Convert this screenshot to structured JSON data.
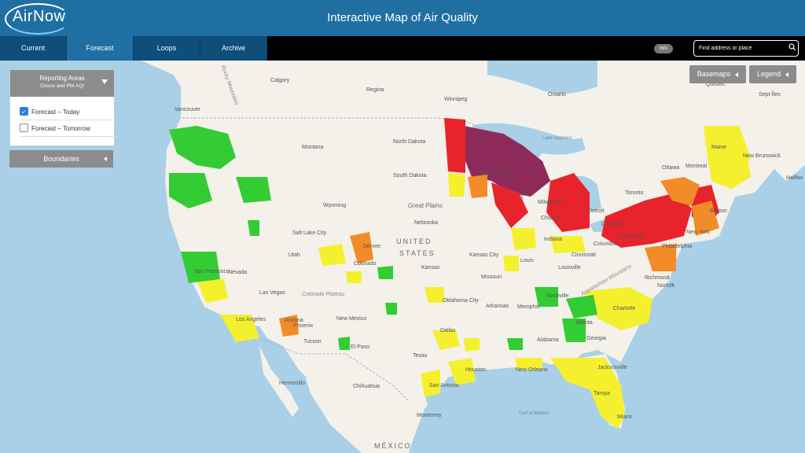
{
  "header": {
    "logo_text": "AirNow",
    "title": "Interactive Map of Air Quality"
  },
  "nav": {
    "tabs": [
      {
        "label": "Current"
      },
      {
        "label": "Forecast"
      },
      {
        "label": "Loops"
      },
      {
        "label": "Archive"
      }
    ]
  },
  "toolbar": {
    "info_label": "Info",
    "search_placeholder": "Find address or place",
    "basemaps_label": "Basemaps",
    "legend_label": "Legend"
  },
  "panel": {
    "title": "Reporting Areas",
    "subtitle": "Ozone and PM AQI",
    "options": [
      {
        "label": "Forecast – Today",
        "checked": true
      },
      {
        "label": "Forecast – Tomorrow",
        "checked": false
      }
    ],
    "boundaries_label": "Boundaries"
  },
  "colors": {
    "good": "#33cc33",
    "moderate": "#f5f02e",
    "usg": "#f28c28",
    "unhealthy": "#e8232b",
    "very_unhealthy": "#8e2a5a"
  },
  "map_labels": {
    "calgary": "Calgary",
    "regina": "Regina",
    "winnipeg": "Winnipeg",
    "vancouver": "Vancouver",
    "ontario": "Ontario",
    "quebec": "Québec",
    "lake_superior": "Lake Superior",
    "sept_iles": "Sept-Îles",
    "north_dakota": "North Dakota",
    "montana": "Montana",
    "south_dakota": "South Dakota",
    "minneapolis": "Minneapolis",
    "wyoming": "Wyoming",
    "great_plains": "Great Plains",
    "united": "UNITED",
    "states": "STATES",
    "nebraska": "Nebraska",
    "salt_lake_city": "Salt Lake City",
    "utah": "Utah",
    "denver": "Denver",
    "colorado": "Colorado",
    "kansas": "Kansas",
    "kansas_city": "Kansas City",
    "missouri": "Missouri",
    "st_louis": "Louis",
    "san_francisco": "San Francisco",
    "nevada": "Nevada",
    "las_vegas": "Las Vegas",
    "colorado_plateau": "Colorado Plateau",
    "los_angeles": "Los Angeles",
    "phoenix": "Phoenix",
    "arizona": "Arizona",
    "tucson": "Tucson",
    "new_mexico": "New Mexico",
    "el_paso": "El Paso",
    "oklahoma_city": "Oklahoma City",
    "arkansas": "Arkansas",
    "memphis": "Memphis",
    "texas": "Texas",
    "dallas": "Dallas",
    "houston": "Houston",
    "san_antonio": "San Antonio",
    "new_orleans": "New Orleans",
    "hermosillo": "Hermosillo",
    "chihuahua": "Chihuahua",
    "mexico": "MÉXICO",
    "monterrey": "Monterrey",
    "gulf_of_mexico": "Gulf of Mexico",
    "jacksonville": "Jacksonville",
    "tampa": "Tampa",
    "miami": "Miami",
    "atlanta": "Atlanta",
    "georgia": "Georgia",
    "alabama": "Alabama",
    "nashville": "Nashville",
    "louisville": "Louisville",
    "cincinnati": "Cincinnati",
    "columbus": "Columbus",
    "indiana": "Indiana",
    "chicago": "Chicago",
    "milwaukee": "Milwaukee",
    "detroit": "Detroit",
    "cleveland": "Cleveland",
    "pittsburgh": "Pittsburgh",
    "philadelphia": "Philadelphia",
    "new_york": "New York",
    "boston": "Boston",
    "toronto": "Toronto",
    "ottawa": "Ottawa",
    "montreal": "Montreal",
    "new_brunswick": "New Brunswick",
    "maine": "Maine",
    "halifax": "Halifax",
    "richmond": "Richmond",
    "norfolk": "Norfolk",
    "charlotte": "Charlotte",
    "appalachian_mountains": "Appalachian Mountains",
    "rocky_mountains": "Rocky Mountains"
  }
}
